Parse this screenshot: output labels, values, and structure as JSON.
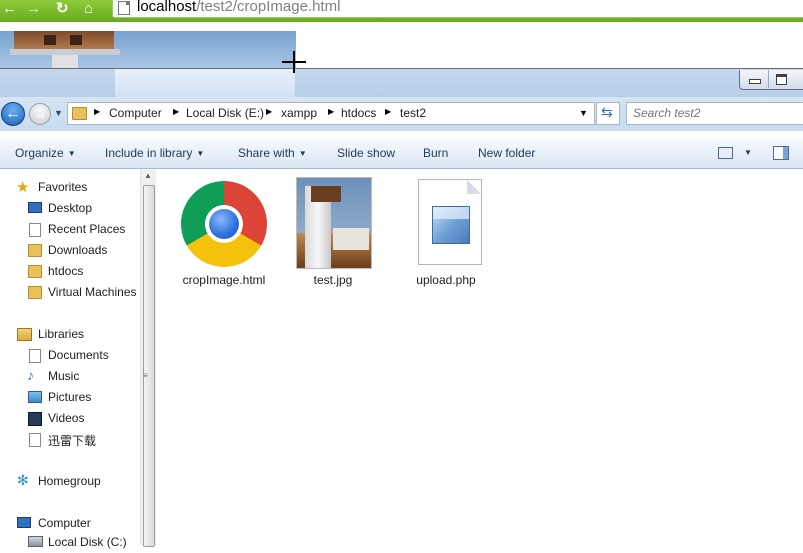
{
  "browser": {
    "url_host": "localhost",
    "url_path": "/test2/cropImage.html"
  },
  "explorer": {
    "breadcrumbs": [
      "Computer",
      "Local Disk (E:)",
      "xampp",
      "htdocs",
      "test2"
    ],
    "search_placeholder": "Search test2",
    "commands": [
      "Organize",
      "Include in library",
      "Share with",
      "Slide show",
      "Burn",
      "New folder"
    ],
    "nav": {
      "favorites": [
        "Favorites",
        "Desktop",
        "Recent Places",
        "Downloads",
        "htdocs",
        "Virtual Machines"
      ],
      "libraries": [
        "Libraries",
        "Documents",
        "Music",
        "Pictures",
        "Videos",
        "迅雷下载"
      ],
      "homegroup": "Homegroup",
      "computer": [
        "Computer",
        "Local Disk (C:)"
      ]
    },
    "files": [
      {
        "name": "cropImage.html",
        "icon": "chrome-icon"
      },
      {
        "name": "test.jpg",
        "icon": "image-thumbnail"
      },
      {
        "name": "upload.php",
        "icon": "php-file-icon"
      }
    ]
  },
  "colors": {
    "browser_accent": "#6aaa1f",
    "explorer_frame": "#c4d8ee"
  }
}
